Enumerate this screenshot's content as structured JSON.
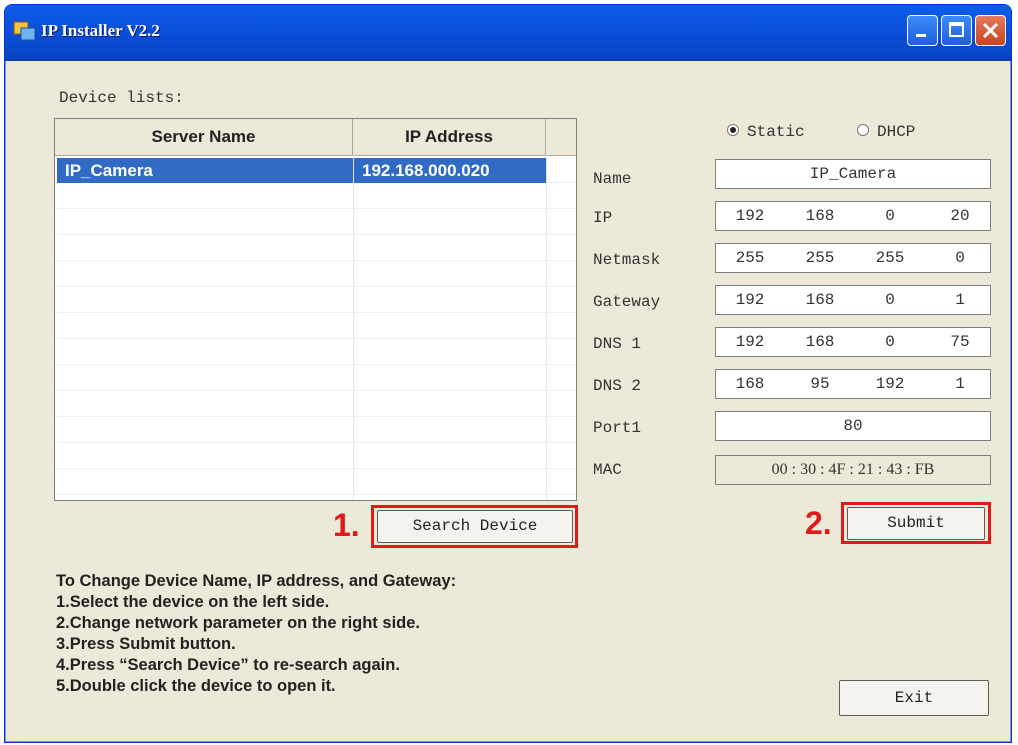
{
  "window": {
    "title": "IP Installer V2.2",
    "colors": {
      "titlebar": "#0a4fd9",
      "background": "#ece9d8",
      "selection": "#316ac5",
      "highlight": "#e01a1a"
    }
  },
  "device_list": {
    "label": "Device lists:",
    "columns": [
      "Server Name",
      "IP Address"
    ],
    "rows": [
      {
        "server_name": "IP_Camera",
        "ip_address": "192.168.000.020",
        "selected": true
      }
    ]
  },
  "mode": {
    "static_label": "Static",
    "dhcp_label": "DHCP",
    "selected": "Static"
  },
  "fields": {
    "name": {
      "label": "Name",
      "value": "IP_Camera"
    },
    "ip": {
      "label": "IP",
      "octets": [
        "192",
        "168",
        "0",
        "20"
      ]
    },
    "netmask": {
      "label": "Netmask",
      "octets": [
        "255",
        "255",
        "255",
        "0"
      ]
    },
    "gateway": {
      "label": "Gateway",
      "octets": [
        "192",
        "168",
        "0",
        "1"
      ]
    },
    "dns1": {
      "label": "DNS 1",
      "octets": [
        "192",
        "168",
        "0",
        "75"
      ]
    },
    "dns2": {
      "label": "DNS 2",
      "octets": [
        "168",
        "95",
        "192",
        "1"
      ]
    },
    "port1": {
      "label": "Port1",
      "value": "80"
    },
    "mac": {
      "label": "MAC",
      "value": "00 : 30 : 4F : 21 : 43 : FB"
    }
  },
  "buttons": {
    "search": "Search Device",
    "submit": "Submit",
    "exit": "Exit"
  },
  "annotations": {
    "step1": "1.",
    "step2": "2."
  },
  "instructions": {
    "heading": "To Change Device Name, IP address, and Gateway:",
    "lines": [
      "1.Select the device on the left side.",
      "2.Change network parameter on the right side.",
      "3.Press Submit button.",
      "4.Press “Search Device” to re-search again.",
      "5.Double click the device to open it."
    ]
  },
  "icons": {
    "app": "ip-installer-icon",
    "minimize": "minimize-icon",
    "maximize": "maximize-icon",
    "close": "close-icon"
  }
}
